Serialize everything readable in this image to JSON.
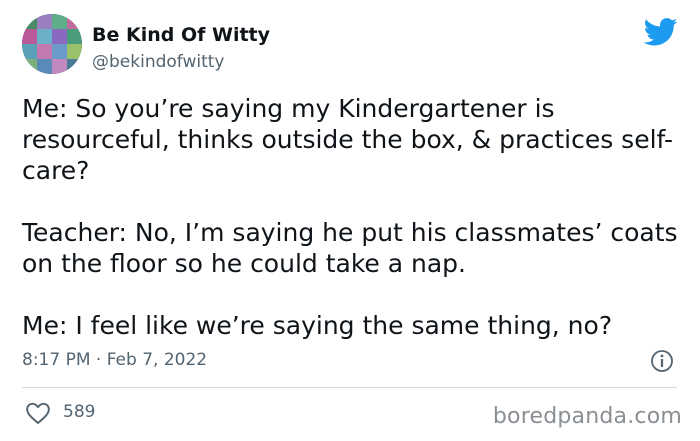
{
  "author": {
    "display_name": "Be Kind Of Witty",
    "handle": "@bekindofwitty"
  },
  "tweet": {
    "paragraphs": [
      "Me: So you’re saying my Kindergartener is resourceful, thinks outside the box, & practices self-care?",
      "Teacher: No, I’m saying he put his classmates’ coats on the floor so he could take a nap.",
      "Me: I feel like we’re saying the same thing, no?"
    ],
    "timestamp": "8:17 PM · Feb 7, 2022",
    "likes": "589"
  },
  "icons": {
    "logo": "twitter-bird-icon",
    "info": "info-icon",
    "like": "heart-icon"
  },
  "watermark": "boredpanda.com",
  "colors": {
    "twitter_blue": "#1d9bf0",
    "text_primary": "#0f1419",
    "text_secondary": "#536471",
    "divider": "#cfd9de",
    "watermark": "#8a8f94"
  }
}
